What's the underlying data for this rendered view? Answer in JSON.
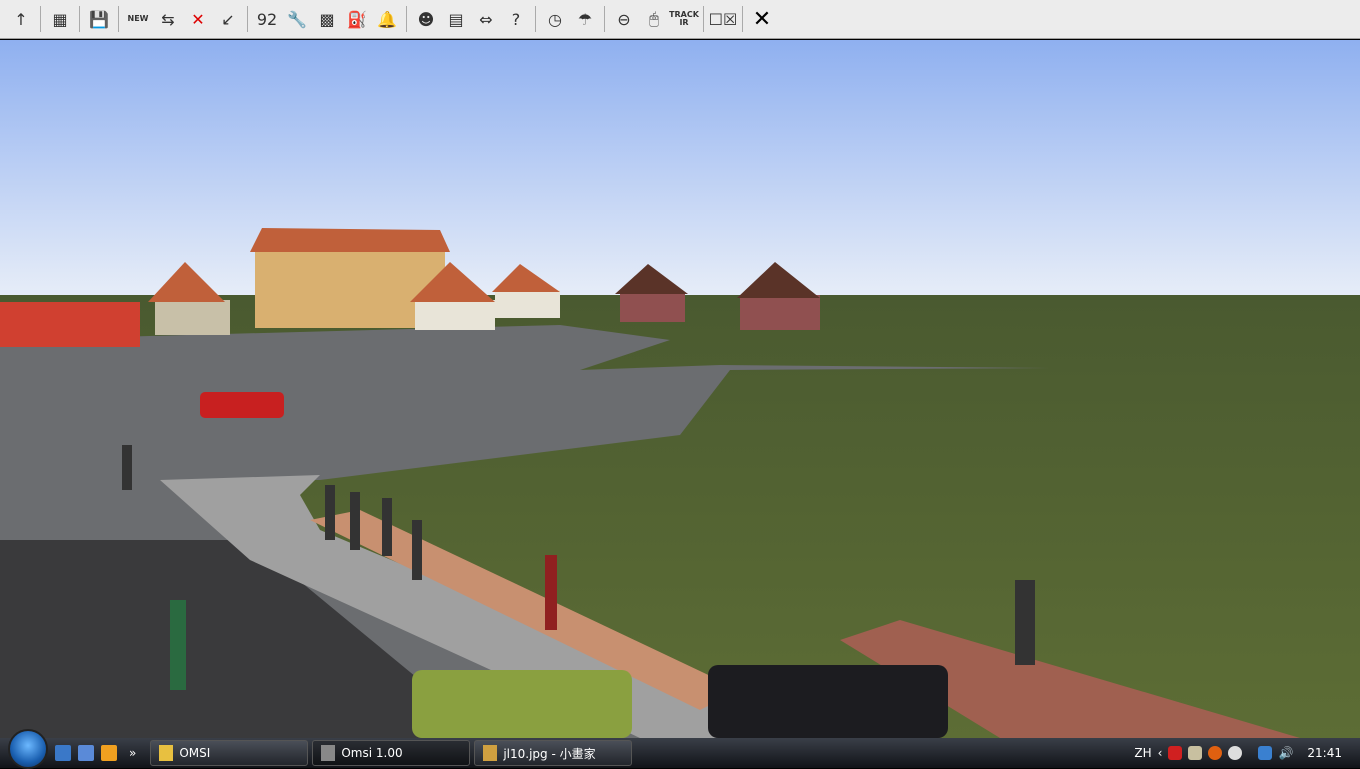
{
  "toolbar": {
    "items": [
      {
        "icon": "up-arrow-icon",
        "glyph": "↑"
      },
      {
        "icon": "map-icon",
        "glyph": "▦"
      },
      {
        "icon": "save-icon",
        "glyph": "💾"
      },
      {
        "icon": "new-bus-icon",
        "glyph": "NEW"
      },
      {
        "icon": "switch-bus-icon",
        "glyph": "⇆"
      },
      {
        "icon": "delete-bus-icon",
        "glyph": "✕"
      },
      {
        "icon": "place-marker-icon",
        "glyph": "↙"
      },
      {
        "icon": "route-number-icon",
        "glyph": "92"
      },
      {
        "icon": "wrench-icon",
        "glyph": "🔧"
      },
      {
        "icon": "chip-icon",
        "glyph": "▩"
      },
      {
        "icon": "fuel-icon",
        "glyph": "⛽"
      },
      {
        "icon": "bell-icon",
        "glyph": "🔔"
      },
      {
        "icon": "driver-icon",
        "glyph": "☻"
      },
      {
        "icon": "timetable-icon",
        "glyph": "▤"
      },
      {
        "icon": "pc-driver-switch-icon",
        "glyph": "⇔"
      },
      {
        "icon": "help-arrow-icon",
        "glyph": "?"
      },
      {
        "icon": "clock-icon",
        "glyph": "◷"
      },
      {
        "icon": "weather-icon",
        "glyph": "☂"
      },
      {
        "icon": "steering-wheel-icon",
        "glyph": "⊖"
      },
      {
        "icon": "mouse-icon",
        "glyph": "🖱"
      },
      {
        "icon": "trackir-icon",
        "glyph": "TRACK IR"
      },
      {
        "icon": "checkbox-options-icon",
        "glyph": "☐☒"
      },
      {
        "icon": "close-icon",
        "glyph": "✕"
      }
    ]
  },
  "taskbar": {
    "tasks": [
      {
        "label": "OMSI"
      },
      {
        "label": "Omsi 1.00"
      },
      {
        "label": "jl10.jpg - 小畫家"
      }
    ],
    "chevron": "»",
    "language": "ZH",
    "time": "21:41"
  }
}
